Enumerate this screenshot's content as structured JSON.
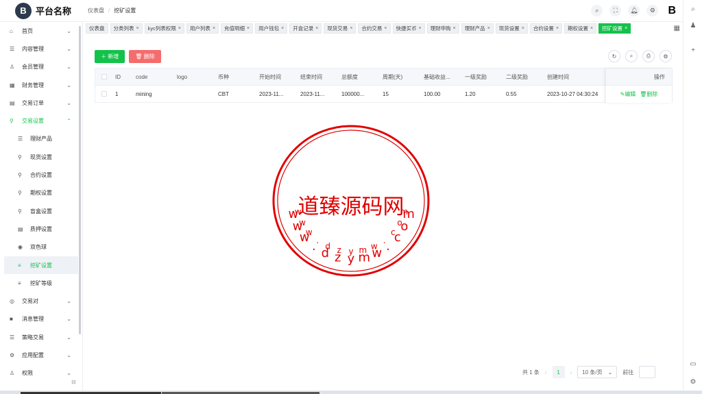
{
  "app": {
    "title": "平台名称",
    "logo_letter": "B",
    "brand_letter": "B"
  },
  "breadcrumb": {
    "root": "仪表盘",
    "current": "挖矿设置"
  },
  "topbar_icons": [
    "search-icon",
    "fullscreen-icon",
    "bell-icon",
    "settings-icon"
  ],
  "sidebar": {
    "items": [
      {
        "label": "首页",
        "icon": "⌂",
        "arrow": "⌄"
      },
      {
        "label": "内容管理",
        "icon": "☰",
        "arrow": "⌄"
      },
      {
        "label": "会员管理",
        "icon": "♙",
        "arrow": "⌄"
      },
      {
        "label": "财务管理",
        "icon": "▦",
        "arrow": "⌄"
      },
      {
        "label": "交易订单",
        "icon": "▤",
        "arrow": "⌄"
      },
      {
        "label": "交易设置",
        "icon": "⚲",
        "arrow": "⌃"
      }
    ],
    "sub_items": [
      {
        "label": "理财产品",
        "icon": "☰"
      },
      {
        "label": "现货设置",
        "icon": "⚲"
      },
      {
        "label": "合约设置",
        "icon": "⚲"
      },
      {
        "label": "期权设置",
        "icon": "⚲"
      },
      {
        "label": "盲盒设置",
        "icon": "⚲"
      },
      {
        "label": "质押设置",
        "icon": "▤"
      },
      {
        "label": "双色球",
        "icon": "◉"
      },
      {
        "label": "挖矿设置",
        "icon": "≡"
      },
      {
        "label": "挖矿等级",
        "icon": "≡"
      }
    ],
    "items_after": [
      {
        "label": "交易对",
        "icon": "◎",
        "arrow": "⌄"
      },
      {
        "label": "消息管理",
        "icon": "■",
        "arrow": "⌄"
      },
      {
        "label": "策略交易",
        "icon": "☰",
        "arrow": "⌄"
      },
      {
        "label": "应用配置",
        "icon": "⚙",
        "arrow": "⌄"
      },
      {
        "label": "权限",
        "icon": "♙",
        "arrow": "⌄"
      }
    ]
  },
  "tabs": [
    {
      "label": "仪表盘",
      "closable": false
    },
    {
      "label": "分类列表",
      "closable": true
    },
    {
      "label": "kyc列表权限",
      "closable": true
    },
    {
      "label": "用户列表",
      "closable": true
    },
    {
      "label": "充值明细",
      "closable": true
    },
    {
      "label": "用户钱包",
      "closable": true
    },
    {
      "label": "开盒记录",
      "closable": true
    },
    {
      "label": "现货交易",
      "closable": true
    },
    {
      "label": "合约交易",
      "closable": true
    },
    {
      "label": "快捷买币",
      "closable": true
    },
    {
      "label": "理财申购",
      "closable": true
    },
    {
      "label": "理财产品",
      "closable": true
    },
    {
      "label": "现货设置",
      "closable": true
    },
    {
      "label": "合约设置",
      "closable": true
    },
    {
      "label": "期权设置",
      "closable": true
    },
    {
      "label": "挖矿设置",
      "closable": true,
      "active": true
    }
  ],
  "toolbar": {
    "add_label": "新增",
    "delete_label": "删除"
  },
  "table": {
    "columns": [
      "ID",
      "code",
      "logo",
      "币种",
      "开始时间",
      "结束时间",
      "总额度",
      "周期(天)",
      "基础收益...",
      "一级奖励",
      "二级奖励",
      "创建时间"
    ],
    "ops_header": "操作",
    "rows": [
      {
        "id": "1",
        "code": "mining",
        "logo": "",
        "coin": "CBT",
        "start": "2023-11...",
        "end": "2023-11...",
        "total": "100000...",
        "period": "15",
        "base_income": "100.00",
        "level1": "1.20",
        "level2": "0.55",
        "created": "2023-10-27 04:30:24",
        "edit": "编辑",
        "delete": "删除"
      }
    ]
  },
  "pagination": {
    "total": "共 1 条",
    "current": "1",
    "page_size": "10 条/页",
    "goto": "前往"
  },
  "watermark": {
    "top_text": "www.dzymw.com",
    "center": "道臻源码网",
    "bottom_text": "www.dzymw.com",
    "color": "#e00000"
  }
}
